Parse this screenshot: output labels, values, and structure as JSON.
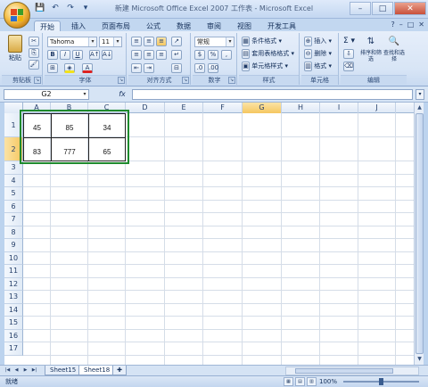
{
  "title": "新建 Microsoft Office Excel 2007 工作表 - Microsoft Excel",
  "qat": [
    "💾",
    "↶",
    "↷",
    "▾"
  ],
  "window_controls": [
    "–",
    "□",
    "✕"
  ],
  "tabs": [
    "开始",
    "插入",
    "页面布局",
    "公式",
    "数据",
    "审阅",
    "视图",
    "开发工具"
  ],
  "tab_right": [
    "?",
    "–",
    "□",
    "✕"
  ],
  "ribbon": {
    "clipboard": {
      "paste": "粘贴",
      "label": "剪贴板"
    },
    "font": {
      "name": "Tahoma",
      "size": "11",
      "label": "字体",
      "bold": "B",
      "italic": "I",
      "underline": "U"
    },
    "alignment": {
      "label": "对齐方式"
    },
    "number": {
      "format": "常规",
      "label": "数字",
      "percent": "%",
      "comma": ","
    },
    "styles": {
      "conditional": "条件格式",
      "table": "套用表格格式",
      "cell": "单元格样式",
      "label": "样式"
    },
    "cells": {
      "insert": "插入",
      "delete": "删除",
      "format": "格式",
      "label": "单元格"
    },
    "editing": {
      "sigma": "Σ",
      "sort": "排序和筛选",
      "find": "查找和选择",
      "label": "编辑"
    }
  },
  "formula_bar": {
    "name_box": "G2",
    "fx": "fx",
    "formula": ""
  },
  "columns": [
    "A",
    "B",
    "C",
    "D",
    "E",
    "F",
    "G",
    "H",
    "I",
    "J"
  ],
  "rows": [
    "1",
    "2",
    "3",
    "4",
    "5",
    "6",
    "7",
    "8",
    "9",
    "10",
    "11",
    "12",
    "13",
    "14",
    "15",
    "16",
    "17"
  ],
  "cells": {
    "A1": "45",
    "B1": "85",
    "C1": "34",
    "A2": "83",
    "B2": "777",
    "C2": "65"
  },
  "sheet_tabs": [
    "Sheet15",
    "Sheet18"
  ],
  "status": {
    "ready": "就绪",
    "zoom": "100%"
  },
  "colors": {
    "selection_border": "#1e8a2d",
    "ribbon_bg": "#dbe7f6",
    "active_header": "#f5c760"
  }
}
